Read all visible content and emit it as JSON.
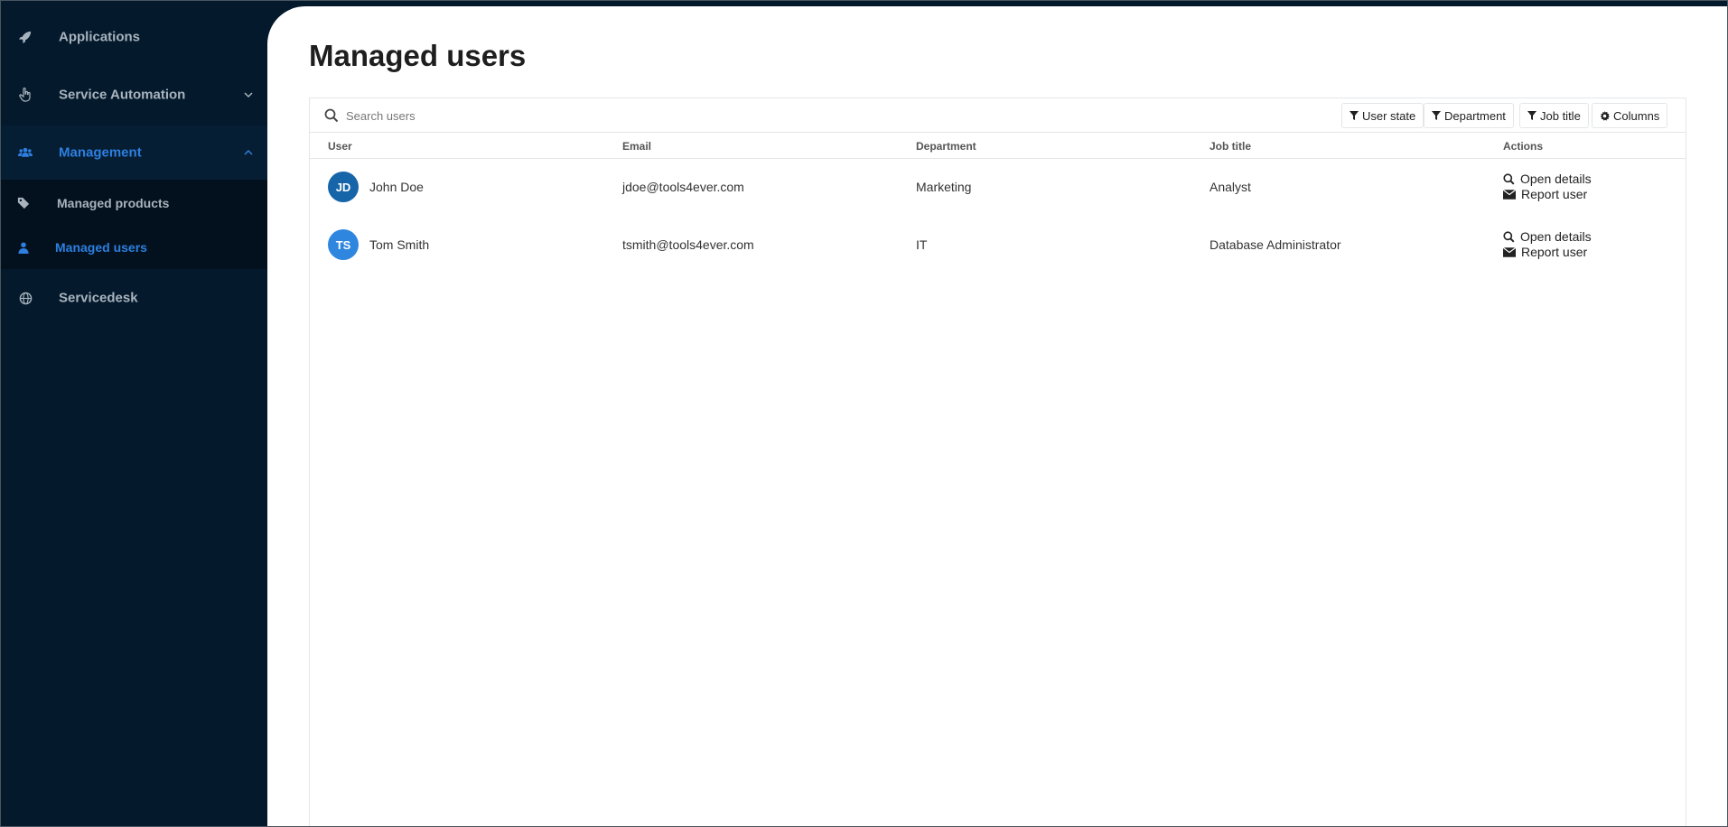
{
  "sidebar": {
    "items": [
      {
        "label": "Applications",
        "icon": "rocket-icon"
      },
      {
        "label": "Service Automation",
        "icon": "pointer-hand-icon"
      },
      {
        "label": "Management",
        "icon": "users-icon"
      },
      {
        "label": "Servicedesk",
        "icon": "globe-icon"
      }
    ],
    "sub_items": [
      {
        "label": "Managed products",
        "icon": "tag-icon"
      },
      {
        "label": "Managed users",
        "icon": "user-icon"
      }
    ],
    "active_color": "#2d7fe0"
  },
  "page": {
    "title": "Managed users"
  },
  "toolbar": {
    "search_placeholder": "Search users",
    "filters": [
      "User state",
      "Department",
      "Job title"
    ],
    "columns_label": "Columns"
  },
  "table": {
    "headers": [
      "User",
      "Email",
      "Department",
      "Job title",
      "Actions"
    ],
    "rows": [
      {
        "initials": "JD",
        "name": "John Doe",
        "email": "jdoe@tools4ever.com",
        "department": "Marketing",
        "job_title": "Analyst",
        "avatar_color": "#1565a8"
      },
      {
        "initials": "TS",
        "name": "Tom Smith",
        "email": "tsmith@tools4ever.com",
        "department": "IT",
        "job_title": "Database Administrator",
        "avatar_color": "#2f86de"
      }
    ],
    "actions": [
      "Open details",
      "Report user"
    ]
  }
}
